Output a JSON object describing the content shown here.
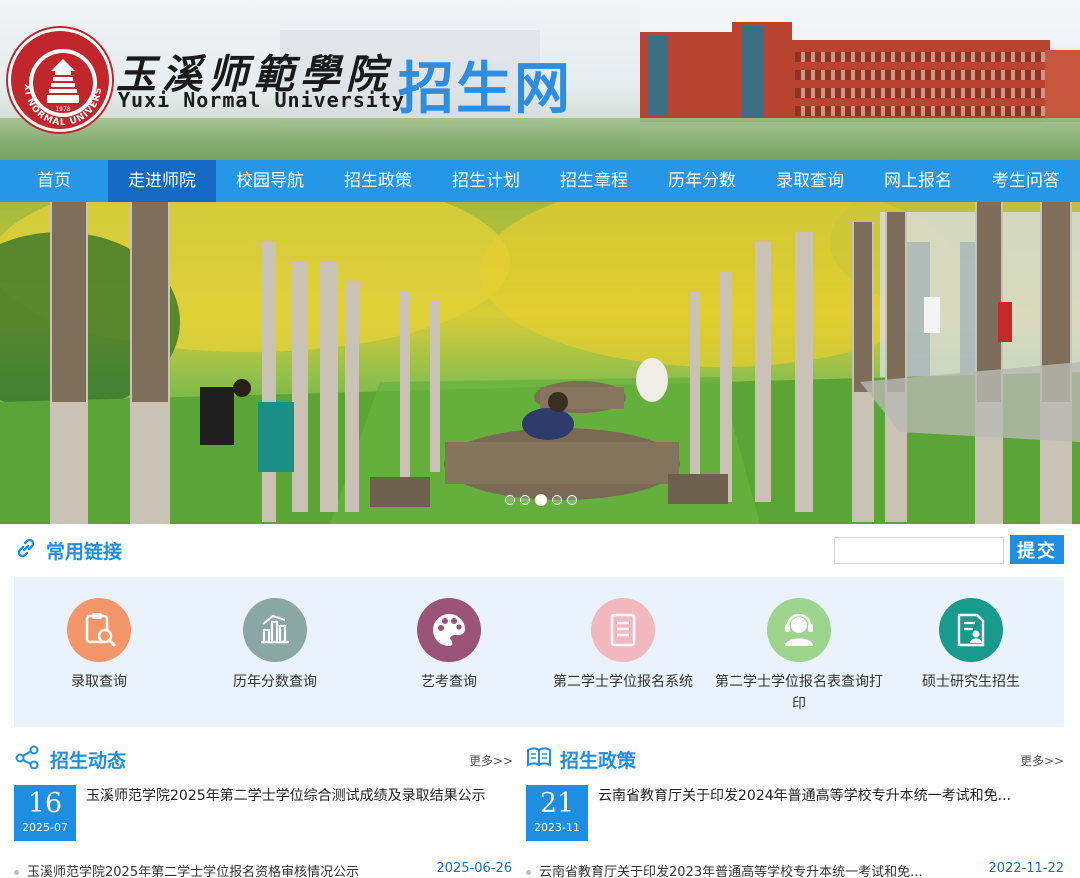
{
  "header": {
    "school_name_cn": "玉溪师範學院",
    "school_name_en": "Yuxi Normal University",
    "site_name": "招生网",
    "seal_text": "YUXI NORMAL UNIVERSITY",
    "seal_year": "1978"
  },
  "nav": [
    {
      "label": "首页",
      "active": false
    },
    {
      "label": "走进师院",
      "active": true
    },
    {
      "label": "校园导航",
      "active": false
    },
    {
      "label": "招生政策",
      "active": false
    },
    {
      "label": "招生计划",
      "active": false
    },
    {
      "label": "招生章程",
      "active": false
    },
    {
      "label": "历年分数",
      "active": false
    },
    {
      "label": "录取查询",
      "active": false
    },
    {
      "label": "网上报名",
      "active": false
    },
    {
      "label": "考生问答",
      "active": false
    }
  ],
  "banner": {
    "slide_count": 5,
    "active_slide": 3
  },
  "links_section": {
    "title": "常用链接",
    "search_value": "",
    "submit_label": "提交",
    "items": [
      {
        "label": "录取查询",
        "icon": "clipboard-search-icon",
        "color": "#f5956a"
      },
      {
        "label": "历年分数查询",
        "icon": "bar-chart-icon",
        "color": "#8aa7a5"
      },
      {
        "label": "艺考查询",
        "icon": "palette-icon",
        "color": "#9b5478"
      },
      {
        "label": "第二学士学位报名系统",
        "icon": "document-list-icon",
        "color": "#f3b8bd"
      },
      {
        "label": "第二学士学位报名表查询打印",
        "icon": "headset-user-icon",
        "color": "#9dd58e"
      },
      {
        "label": "硕士研究生招生",
        "icon": "document-user-icon",
        "color": "#1a9a8c"
      }
    ]
  },
  "news": {
    "title": "招生动态",
    "more_label": "更多>>",
    "feature": {
      "day": "16",
      "year_month": "2025-07",
      "title": "玉溪师范学院2025年第二学士学位综合测试成绩及录取结果公示"
    },
    "list": [
      {
        "title": "玉溪师范学院2025年第二学士学位报名资格审核情况公示",
        "date": "2025-06-26"
      }
    ]
  },
  "policy": {
    "title": "招生政策",
    "more_label": "更多>>",
    "feature": {
      "day": "21",
      "year_month": "2023-11",
      "title": "云南省教育厅关于印发2024年普通高等学校专升本统一考试和免..."
    },
    "list": [
      {
        "title": "云南省教育厅关于印发2023年普通高等学校专升本统一考试和免...",
        "date": "2022-11-22"
      }
    ]
  },
  "colors": {
    "nav_bg": "#2697e6",
    "nav_active": "#1369c3",
    "accent": "#1e8ee0",
    "seal_red": "#c0272d"
  }
}
